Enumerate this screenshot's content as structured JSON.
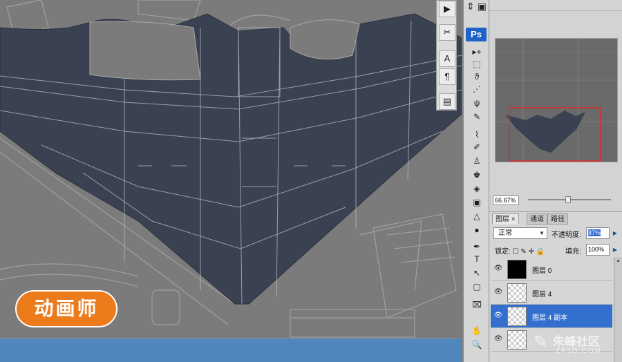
{
  "canvas": {
    "badge_text": "动画师"
  },
  "float_panel": {
    "buttons": [
      "▶",
      "✂",
      "A",
      "¶",
      "▤"
    ]
  },
  "toolbar": {
    "ps_logo": "Ps",
    "tools": [
      "▸+",
      "⬚",
      "ϑ",
      "⋰",
      "ψ",
      "✎",
      "⌇",
      "✐",
      "♙",
      "♚",
      "◈",
      "▣",
      "△",
      "●",
      "✒",
      "T",
      "↖",
      "▢",
      "⌧",
      "✋",
      "🔍"
    ]
  },
  "navigator": {
    "zoom": "66.67%"
  },
  "layers": {
    "tabs": [
      "图层 ×",
      "通道",
      "路径"
    ],
    "blend_mode": "正常",
    "opacity_label": "不透明度:",
    "opacity_value": "87%",
    "lock_label": "锁定:",
    "fill_label": "填充:",
    "fill_value": "100%",
    "items": [
      {
        "name": "图层 0",
        "thumb": "black",
        "selected": false
      },
      {
        "name": "图层 4",
        "thumb": "checker",
        "selected": false
      },
      {
        "name": "图层 4 副本",
        "thumb": "checker",
        "selected": true
      },
      {
        "name": "",
        "thumb": "checker",
        "selected": false
      }
    ]
  },
  "watermark": {
    "main": "朱峰社区",
    "sub": "ZF3D.COM"
  },
  "colors": {
    "accent": "#326fcf",
    "badge": "#ec7b1c",
    "taskbar": "#4f86bb",
    "shape": "#3a4150"
  }
}
